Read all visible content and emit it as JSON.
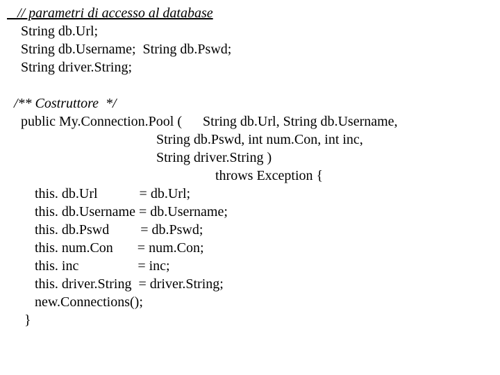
{
  "lines": {
    "l1": "   // parametri di accesso al database",
    "l2": "    String db.Url;",
    "l3": "    String db.Username;  String db.Pswd;",
    "l4": "    String driver.String;",
    "l5": "  /** Costruttore  */",
    "l6": "    public My.Connection.Pool (      String db.Url, String db.Username,",
    "l7": "                                           String db.Pswd, int num.Con, int inc,",
    "l8": "                                           String driver.String )",
    "l9": "                                                            throws Exception {",
    "l10": "        this. db.Url            = db.Url;",
    "l11": "        this. db.Username = db.Username;",
    "l12": "        this. db.Pswd         = db.Pswd;",
    "l13": "        this. num.Con       = num.Con;",
    "l14": "        this. inc                 = inc;",
    "l15": "        this. driver.String  = driver.String;",
    "l16": "        new.Connections();",
    "l17": "     }"
  }
}
